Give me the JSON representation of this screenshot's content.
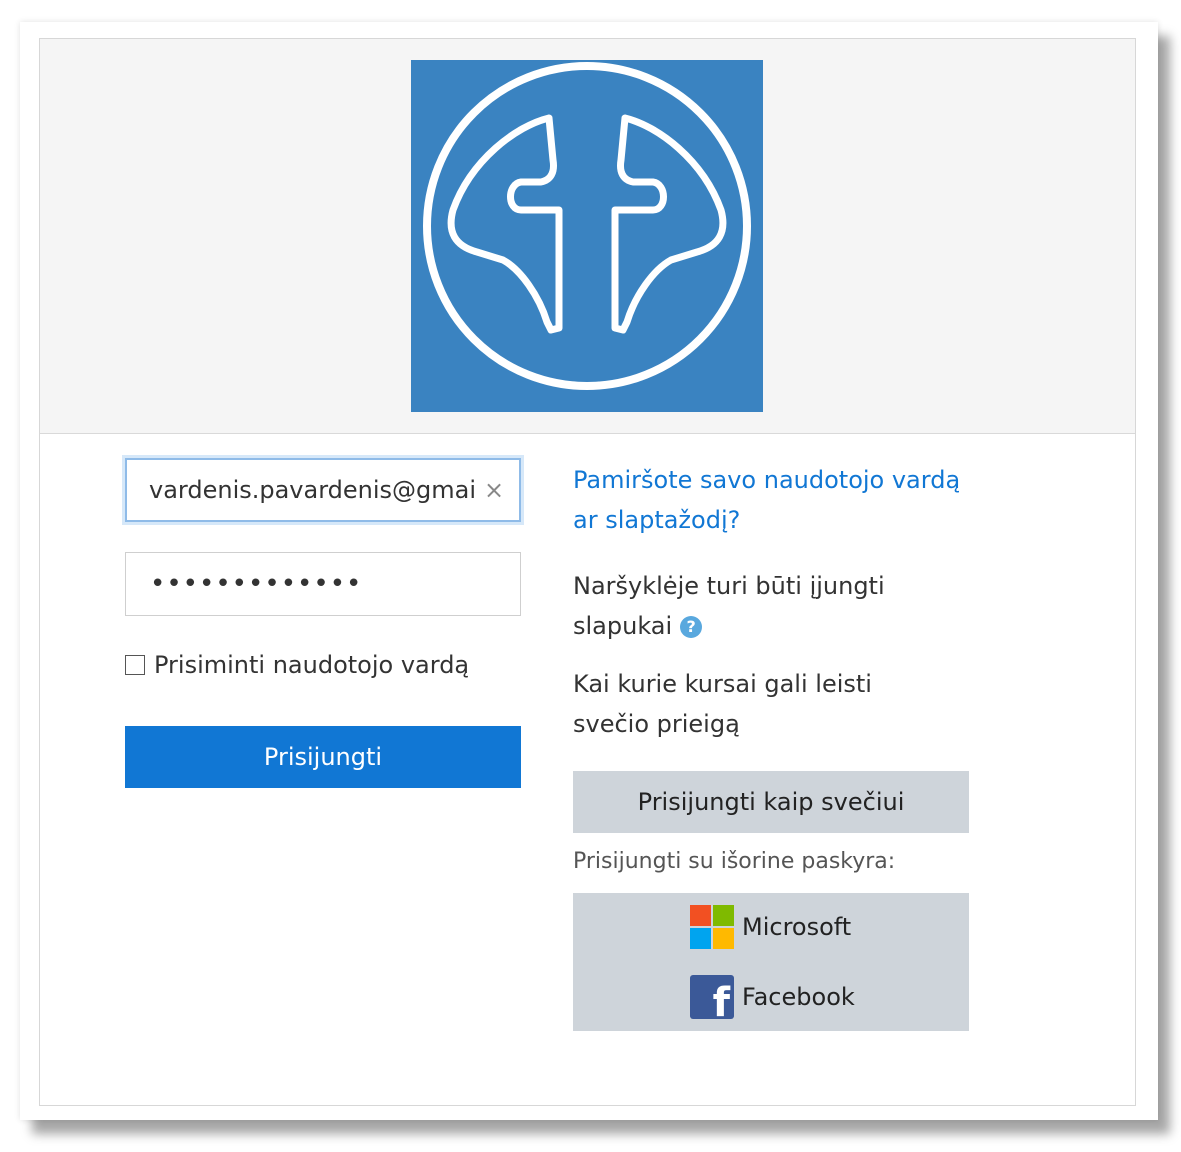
{
  "login": {
    "username_value": "vardenis.pavardenis@gmai",
    "clear_symbol": "×",
    "password_mask": "•••••••••••••",
    "remember_label": "Prisiminti naudotojo vardą",
    "login_button": "Prisijungti"
  },
  "info": {
    "forgot_link": "Pamiršote savo naudotojo vardą ar slaptažodį?",
    "cookies_text": "Naršyklėje turi būti įjungti slapukai",
    "help_symbol": "?",
    "guest_text": "Kai kurie kursai gali leisti svečio prieigą",
    "guest_button": "Prisijungti kaip svečiui",
    "external_label": "Prisijungti su išorine paskyra:"
  },
  "external": {
    "microsoft_label": "Microsoft",
    "facebook_label": "Facebook",
    "facebook_glyph": "f"
  },
  "colors": {
    "logo_bg": "#3a83c1",
    "primary": "#1177d4",
    "secondary_btn": "#ced4da"
  },
  "icons": [
    "logo-emblem-icon",
    "clear-icon",
    "help-icon",
    "microsoft-icon",
    "facebook-icon"
  ]
}
